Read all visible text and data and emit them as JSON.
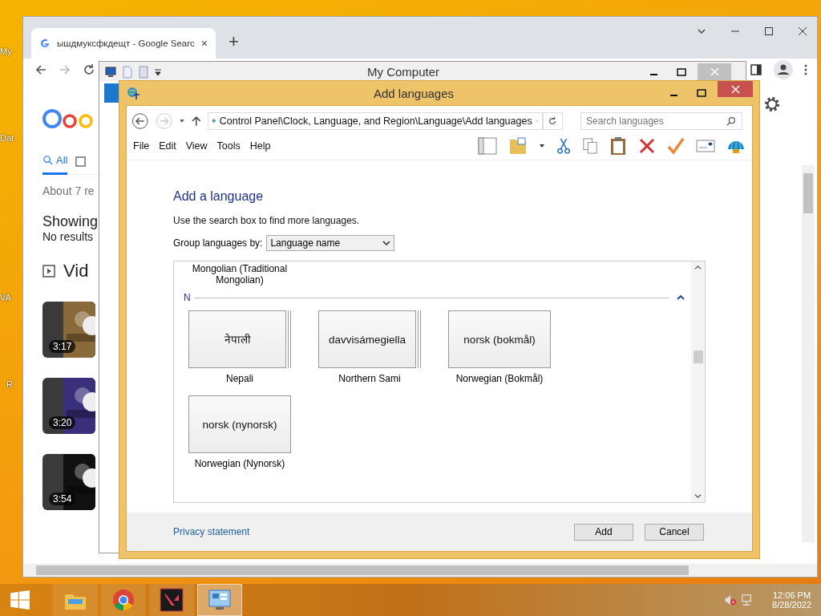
{
  "desktop_icons": [
    {
      "label": "My"
    },
    {
      "label": "Dat"
    },
    {
      "label": "VA"
    },
    {
      "label": "R"
    }
  ],
  "browser": {
    "tab": {
      "title": "ышдмуксфкдещт - Google Searc",
      "close": "×"
    },
    "new_tab": "+",
    "search_tabs": [
      {
        "label": "All",
        "selected": true
      }
    ],
    "result_stats": "About 7 re",
    "showing": "Showing",
    "no_results": "No results",
    "videos_heading": "Vid",
    "videos": [
      {
        "duration": "3:17"
      },
      {
        "duration": "3:20"
      },
      {
        "duration": "3:54"
      }
    ]
  },
  "explorer": {
    "title": "My Computer"
  },
  "dialog": {
    "title": "Add languages",
    "address": "Control Panel\\Clock, Language, and Region\\Language\\Add languages",
    "search": {
      "placeholder": "Search languages"
    },
    "menu": [
      "File",
      "Edit",
      "View",
      "Tools",
      "Help"
    ],
    "heading": "Add a language",
    "hint": "Use the search box to find more languages.",
    "group_label": "Group languages by:",
    "group_value": "Language name",
    "partial_item": "Mongolian (Traditional Mongolian)",
    "groups": [
      {
        "letter": "N",
        "expanded": true,
        "languages": [
          {
            "native": "नेपाली",
            "name": "Nepali",
            "stacked": true
          },
          {
            "native": "davvisámegiella",
            "name": "Northern Sami",
            "stacked": true
          },
          {
            "native": "norsk (bokmål)",
            "name": "Norwegian (Bokmål)",
            "stacked": false
          },
          {
            "native": "norsk (nynorsk)",
            "name": "Norwegian (Nynorsk)",
            "stacked": false
          }
        ]
      }
    ],
    "privacy_link": "Privacy statement",
    "buttons": [
      "Add",
      "Cancel"
    ]
  },
  "taskbar": {
    "apps": [
      {
        "kind": "explorer",
        "active": false
      },
      {
        "kind": "chrome",
        "active": false
      },
      {
        "kind": "valorant",
        "active": false
      },
      {
        "kind": "control-panel",
        "active": true
      }
    ],
    "time": "12:06 PM",
    "date": "8/28/2022"
  }
}
